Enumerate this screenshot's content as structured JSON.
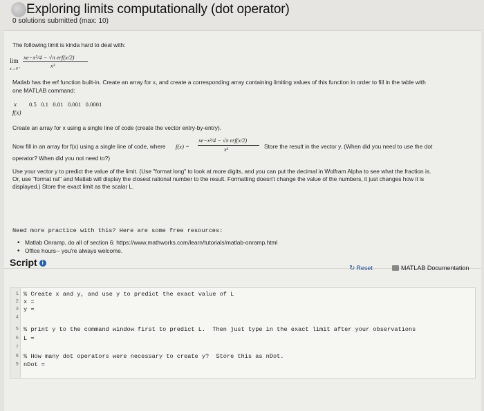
{
  "header": {
    "title": "Exploring limits computationally (dot operator)",
    "subtitle": "0 solutions submitted (max: 10)"
  },
  "problem": {
    "intro": "The following limit is kinda hard to deal with:",
    "lim": "lim",
    "lim_sub": "x→0⁺",
    "expr_num": "xe−x²/4 − √π erf(x/2)",
    "expr_den": "x³",
    "p1_line1": "Matlab has the erf function built-in. Create an array for x, and create a corresponding array containing limiting values of this function in order to fill in the table with",
    "p1_line2": "one MATLAB command:",
    "table_x_label": "x",
    "table_x_values": "0.5   0.1   0.01   0.001   0.0001",
    "table_f_label": "f(x)",
    "p2": "Create an array for x using a single line of code (create the vector entry-by-entry).",
    "p3_a": "Now fill in an array for f(x) using a single line of code, where",
    "p3_f": "f(x) =",
    "p3_b": "Store the result in the vector y. (When did you need to use the dot",
    "p3_c": "operator? When did you not need to?)",
    "p4_line1": "Use your vector y to predict the value of the limit. (Use \"format long\" to look at more digits, and you can put the decimal in Wolfram Alpha to see what the fraction is.",
    "p4_line2": "Or, use \"format rat\" and Matlab will display the closest rational number to the result. Formatting doesn't change the value of the numbers, it just changes how it is",
    "p4_line3": "displayed.) Store the exact limit as the scalar L.",
    "practice": "Need more practice with this?  Here are some free resources:",
    "bullet1": "Matlab Onramp, do all of section 6: https://www.mathworks.com/learn/tutorials/matlab-onramp.html",
    "bullet2": "Office hours-- you're always welcome."
  },
  "script": {
    "label": "Script",
    "reset": "Reset",
    "docs": "MATLAB Documentation",
    "lines": [
      {
        "n": "1",
        "text": "% Create x and y, and use y to predict the exact value of L"
      },
      {
        "n": "2",
        "text": "x ="
      },
      {
        "n": "3",
        "text": "y ="
      },
      {
        "n": "4",
        "text": ""
      },
      {
        "n": "5",
        "text": "% print y to the command window first to predict L.  Then just type in the exact limit after your observations"
      },
      {
        "n": "6",
        "text": "L ="
      },
      {
        "n": "7",
        "text": ""
      },
      {
        "n": "8",
        "text": "% How many dot operators were necessary to create y?  Store this as nDot."
      },
      {
        "n": "9",
        "text": "nDot ="
      }
    ]
  },
  "colors": {
    "accent": "#1f5fae",
    "background": "#e4e3df"
  }
}
